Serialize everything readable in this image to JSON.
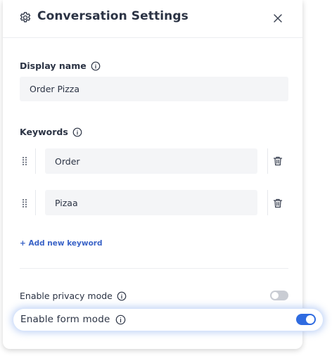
{
  "header": {
    "title": "Conversation Settings",
    "icon": "gear-icon",
    "close_icon": "close-icon"
  },
  "display_name": {
    "label": "Display name",
    "value": "Order Pizza"
  },
  "keywords": {
    "label": "Keywords",
    "items": [
      {
        "value": "Order"
      },
      {
        "value": "Pizaa"
      }
    ],
    "add_label": "+ Add new keyword"
  },
  "privacy_mode": {
    "label": "Enable privacy mode",
    "enabled": false
  },
  "form_mode": {
    "label": "Enable form mode",
    "enabled": true
  },
  "colors": {
    "accent": "#2f6be0",
    "link": "#3a63c7",
    "text": "#2b3344",
    "input_bg": "#f4f5f7"
  }
}
